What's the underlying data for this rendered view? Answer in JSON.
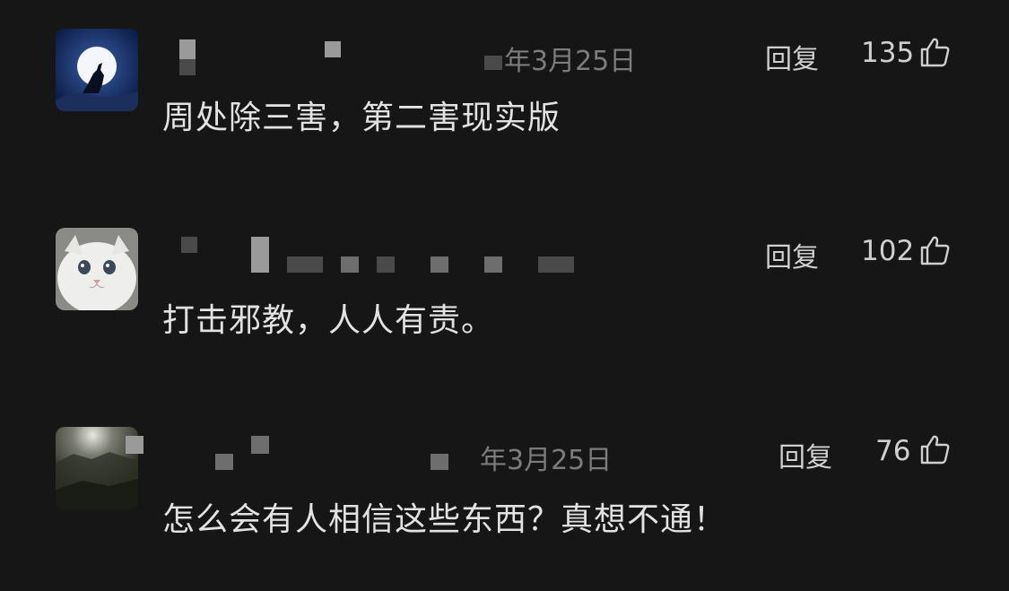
{
  "comments": [
    {
      "date": "年3月25日",
      "reply_label": "回复",
      "likes": "135",
      "text": "周处除三害，第二害现实版",
      "avatar_icon": "wolf-moon-avatar"
    },
    {
      "date": "",
      "reply_label": "回复",
      "likes": "102",
      "text": "打击邪教，人人有责。",
      "avatar_icon": "white-cat-avatar"
    },
    {
      "date": "年3月25日",
      "reply_label": "回复",
      "likes": "76",
      "text": "怎么会有人相信这些东西？真想不通！",
      "avatar_icon": "dark-photo-avatar"
    }
  ],
  "colors": {
    "background": "#161616",
    "text": "#e2e2e2",
    "meta": "#7c7c7c"
  }
}
